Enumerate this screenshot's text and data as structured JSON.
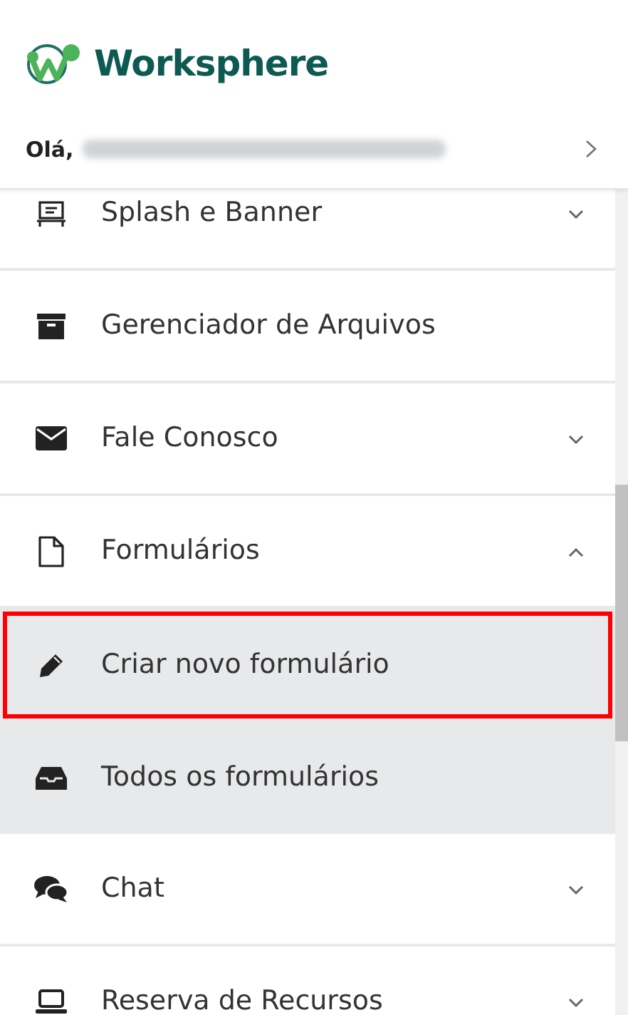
{
  "brand": {
    "name": "Worksphere"
  },
  "greeting": {
    "label": "Olá,",
    "name_blurred": true
  },
  "menu": [
    {
      "label": "Splash e Banner",
      "kind": "group",
      "expanded": false
    },
    {
      "label": "Gerenciador de Arquivos",
      "kind": "link"
    },
    {
      "label": "Fale Conosco",
      "kind": "group",
      "expanded": false
    },
    {
      "label": "Formulários",
      "kind": "group",
      "expanded": true,
      "children": [
        {
          "label": "Criar novo formulário",
          "highlighted": true
        },
        {
          "label": "Todos os formulários",
          "highlighted": false
        }
      ]
    },
    {
      "label": "Chat",
      "kind": "group",
      "expanded": false
    },
    {
      "label": "Reserva de Recursos",
      "kind": "group",
      "expanded": false
    }
  ]
}
